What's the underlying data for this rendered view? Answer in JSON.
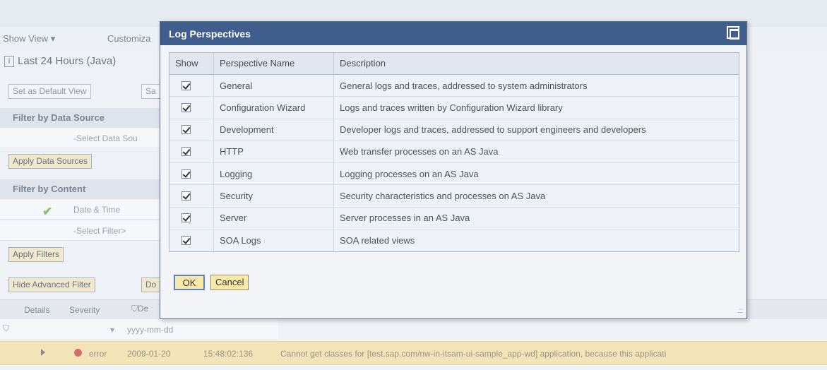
{
  "background": {
    "menu": {
      "show_view": "Show View",
      "customize": "Customiza"
    },
    "view_title": "Last 24 Hours (Java)",
    "info_icon_char": "i",
    "set_default_view": "Set as Default View",
    "save_partial": "Sa",
    "filter_data_source_heading": "Filter by Data Source",
    "select_data_source_placeholder": "-Select Data Sou",
    "apply_data_sources": "Apply Data Sources",
    "filter_content_heading": "Filter by Content",
    "date_time_label": "Date & Time",
    "select_filter_placeholder": "-Select Filter>",
    "apply_filters": "Apply Filters",
    "hide_advanced_filter": "Hide Advanced Filter",
    "do_partial": "Do",
    "grid_columns": {
      "details": "Details",
      "severity": "Severity",
      "date_partial": "De"
    },
    "date_filter_placeholder": "yyyy-mm-dd",
    "log_row": {
      "severity": "error",
      "date": "2009-01-20",
      "time": "15:48:02:136",
      "message": "Cannot get classes for [test.sap.com/nw-in-itsam-ui-sample_app-wd] application, because this applicati"
    }
  },
  "dialog": {
    "title": "Log Perspectives",
    "columns": {
      "show": "Show",
      "name": "Perspective Name",
      "description": "Description"
    },
    "rows": [
      {
        "checked": true,
        "name": "General",
        "description": "General logs and traces, addressed to system administrators"
      },
      {
        "checked": true,
        "name": "Configuration Wizard",
        "description": "Logs and traces written by Configuration Wizard library"
      },
      {
        "checked": true,
        "name": "Development",
        "description": "Developer logs and traces, addressed to support engineers and developers"
      },
      {
        "checked": true,
        "name": "HTTP",
        "description": "Web transfer processes on an AS Java"
      },
      {
        "checked": true,
        "name": "Logging",
        "description": "Logging processes on an AS Java"
      },
      {
        "checked": true,
        "name": "Security",
        "description": "Security characteristics and processes on AS Java"
      },
      {
        "checked": true,
        "name": "Server",
        "description": "Server processes in an AS Java"
      },
      {
        "checked": true,
        "name": "SOA Logs",
        "description": "SOA related views"
      }
    ],
    "ok_label": "OK",
    "cancel_label": "Cancel"
  },
  "colors": {
    "dialog_title_bar": "#3f5e8e",
    "button_fill": "#f9e9a8",
    "error_row": "#f3e3b8"
  }
}
